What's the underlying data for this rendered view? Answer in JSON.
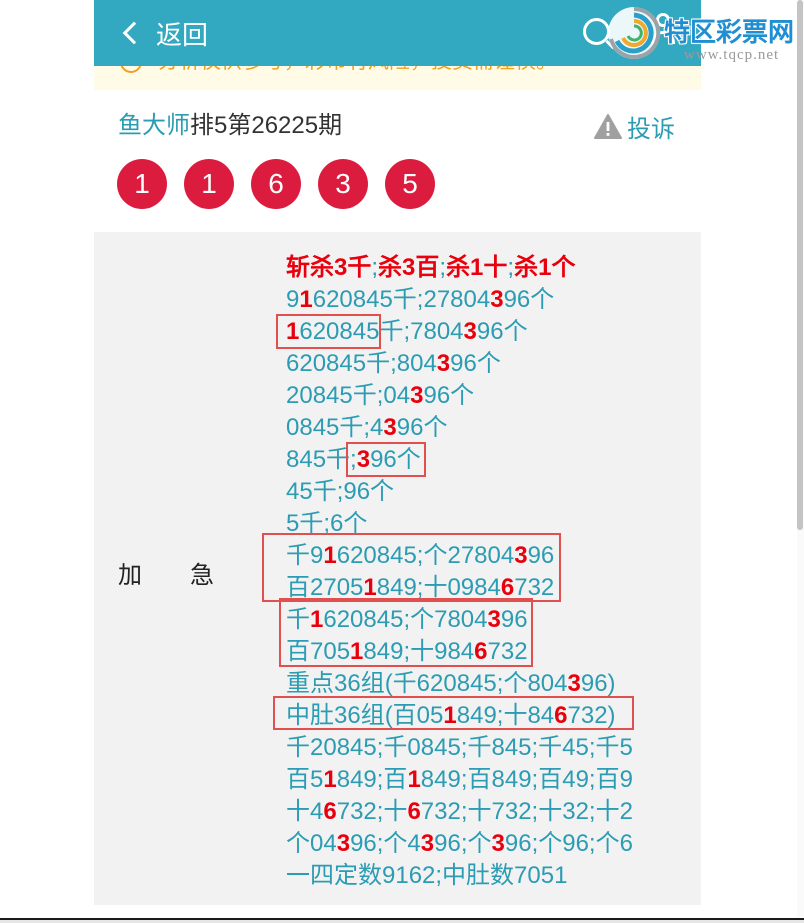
{
  "header": {
    "back_label": "返回",
    "back_icon": "chevron-left-icon",
    "search_icon": "search-icon",
    "user_icon": "user-icon",
    "bg_color": "#33a8c1"
  },
  "watermark": {
    "icon": "swirl-logo-icon",
    "name": "特区彩票网",
    "url": "www.tqcp.net"
  },
  "notice": {
    "icon": "info-circle-icon",
    "text": "分析仅供参考，彩市有风险，投资需谨慎。"
  },
  "post": {
    "expert": "鱼大师",
    "issue": "排5第26225期",
    "report_label": "投诉",
    "report_icon": "warning-triangle-icon"
  },
  "draw": {
    "numbers": [
      "1",
      "1",
      "6",
      "3",
      "5"
    ],
    "ball_color": "#dc1c3f"
  },
  "analysis": {
    "label": "加　　急",
    "text_color": "#2b9cb3",
    "emphasis_color": "#e8000d",
    "rows": [
      {
        "segs": [
          {
            "t": "斩杀3千",
            "em": true
          },
          {
            "t": ";"
          },
          {
            "t": "杀3百",
            "em": true
          },
          {
            "t": ";"
          },
          {
            "t": "杀1十",
            "em": true
          },
          {
            "t": ";"
          },
          {
            "t": "杀1个",
            "em": true
          }
        ]
      },
      {
        "segs": [
          {
            "t": "9"
          },
          {
            "t": "1",
            "em": true
          },
          {
            "t": "620845千;27804"
          },
          {
            "t": "3",
            "em": true
          },
          {
            "t": "96个"
          }
        ]
      },
      {
        "segs": [
          {
            "mark": [
              {
                "t": "1",
                "em": true
              },
              {
                "t": "620845"
              }
            ]
          },
          {
            "t": "千;7804"
          },
          {
            "t": "3",
            "em": true
          },
          {
            "t": "96个"
          }
        ]
      },
      {
        "segs": [
          {
            "t": "620845千;804"
          },
          {
            "t": "3",
            "em": true
          },
          {
            "t": "96个"
          }
        ]
      },
      {
        "segs": [
          {
            "t": "20845千;04"
          },
          {
            "t": "3",
            "em": true
          },
          {
            "t": "96个"
          }
        ]
      },
      {
        "segs": [
          {
            "t": "0845千;4"
          },
          {
            "t": "3",
            "em": true
          },
          {
            "t": "96个"
          }
        ]
      },
      {
        "segs": [
          {
            "t": "845千"
          },
          {
            "mark": [
              {
                "t": ";"
              },
              {
                "t": "3",
                "em": true
              },
              {
                "t": "96个"
              }
            ]
          }
        ]
      },
      {
        "segs": [
          {
            "t": "45千;96个"
          }
        ]
      },
      {
        "segs": [
          {
            "t": "5千;6个"
          }
        ]
      },
      {
        "mark_rows": [
          {
            "segs": [
              {
                "t": "千9"
              },
              {
                "t": "1",
                "em": true
              },
              {
                "t": "620845;个27804"
              },
              {
                "t": "3",
                "em": true
              },
              {
                "t": "96"
              }
            ]
          },
          {
            "segs": [
              {
                "t": "百2705"
              },
              {
                "t": "1",
                "em": true
              },
              {
                "t": "849;十0984"
              },
              {
                "t": "6",
                "em": true
              },
              {
                "t": "732"
              }
            ]
          }
        ]
      },
      {
        "mark_rows": [
          {
            "segs": [
              {
                "t": "千"
              },
              {
                "t": "1",
                "em": true
              },
              {
                "t": "620845;个7804"
              },
              {
                "t": "3",
                "em": true
              },
              {
                "t": "96"
              }
            ]
          },
          {
            "segs": [
              {
                "t": "百705"
              },
              {
                "t": "1",
                "em": true
              },
              {
                "t": "849;十984"
              },
              {
                "t": "6",
                "em": true
              },
              {
                "t": "732"
              }
            ]
          }
        ]
      },
      {
        "segs": [
          {
            "t": "重点36组(千620845;个804"
          },
          {
            "t": "3",
            "em": true
          },
          {
            "t": "96)"
          }
        ]
      },
      {
        "mark_rows": [
          {
            "segs": [
              {
                "t": "中肚36组(百05"
              },
              {
                "t": "1",
                "em": true
              },
              {
                "t": "849;十84"
              },
              {
                "t": "6",
                "em": true
              },
              {
                "t": "732)"
              }
            ]
          }
        ]
      },
      {
        "segs": [
          {
            "t": "千20845;千0845;千845;千45;千5"
          }
        ]
      },
      {
        "segs": [
          {
            "t": "百5"
          },
          {
            "t": "1",
            "em": true
          },
          {
            "t": "849;百"
          },
          {
            "t": "1",
            "em": true
          },
          {
            "t": "849;百849;百49;百9"
          }
        ]
      },
      {
        "segs": [
          {
            "t": "十4"
          },
          {
            "t": "6",
            "em": true
          },
          {
            "t": "732;十"
          },
          {
            "t": "6",
            "em": true
          },
          {
            "t": "732;十732;十32;十2"
          }
        ]
      },
      {
        "segs": [
          {
            "t": "个04"
          },
          {
            "t": "3",
            "em": true
          },
          {
            "t": "96;个4"
          },
          {
            "t": "3",
            "em": true
          },
          {
            "t": "96;个"
          },
          {
            "t": "3",
            "em": true
          },
          {
            "t": "96;个96;个6"
          }
        ]
      },
      {
        "segs": [
          {
            "t": "一四定数9162;中肚数7051"
          }
        ]
      }
    ]
  }
}
